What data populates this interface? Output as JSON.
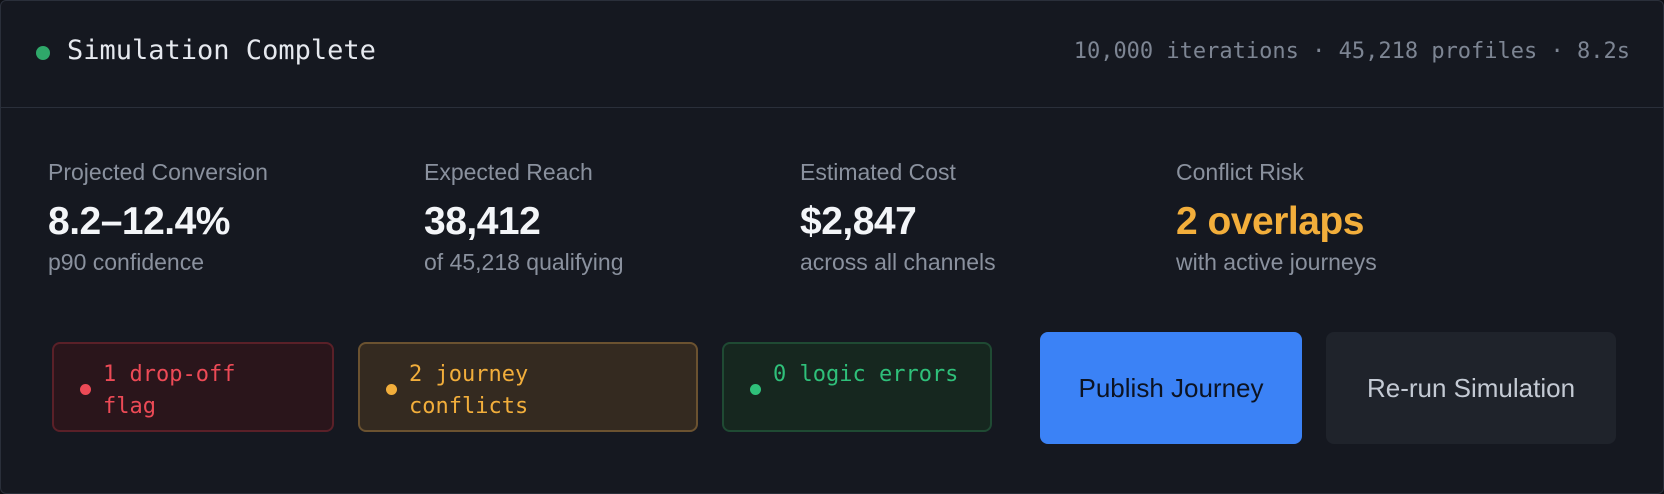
{
  "header": {
    "title": "Simulation Complete",
    "stats": "10,000 iterations · 45,218 profiles · 8.2s",
    "status_color": "#2fa86a"
  },
  "metrics": [
    {
      "label": "Projected Conversion",
      "value": "8.2–12.4%",
      "sub": "p90 confidence"
    },
    {
      "label": "Expected Reach",
      "value": "38,412",
      "sub": "of 45,218 qualifying"
    },
    {
      "label": "Estimated Cost",
      "value": "$2,847",
      "sub": "across all channels"
    },
    {
      "label": "Conflict Risk",
      "value": "2 overlaps",
      "sub": "with active journeys",
      "color": "#f2ae3b"
    }
  ],
  "flags": [
    {
      "text": "1 drop-off flag",
      "color": "#ec4a56"
    },
    {
      "text": "2 journey conflicts",
      "color": "#f2ae3b"
    },
    {
      "text": "0 logic errors",
      "color": "#2fc07a"
    }
  ],
  "actions": {
    "publish_label": "Publish Journey",
    "rerun_label": "Re-run Simulation",
    "primary_color": "#3b82f6"
  }
}
